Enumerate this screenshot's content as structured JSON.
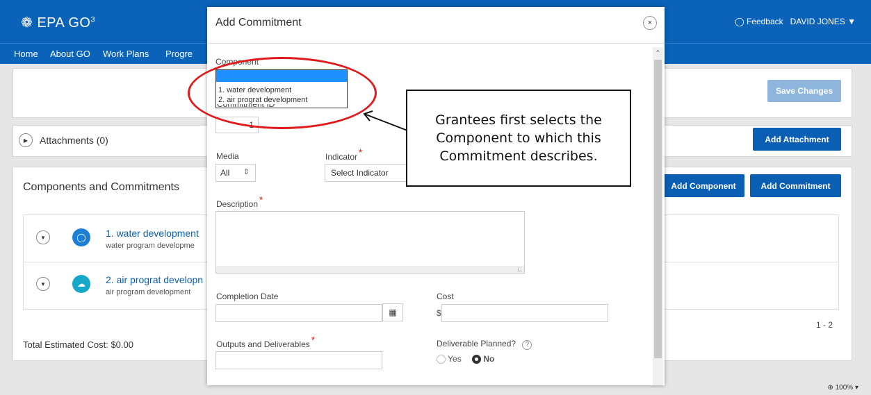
{
  "header": {
    "logo": "EPA GO",
    "logo_sup": "3",
    "feedback": "Feedback",
    "user": "DAVID JONES"
  },
  "nav": {
    "items": [
      "Home",
      "About GO",
      "Work Plans",
      "Progre"
    ]
  },
  "background": {
    "save_changes": "Save Changes",
    "attachments_label": "Attachments (0)",
    "add_attachment": "Add Attachment",
    "components_heading": "Components and Commitments",
    "add_component": "Add Component",
    "add_commitment": "Add Commitment",
    "components": [
      {
        "title": "1. water development",
        "subtitle": "water program developme",
        "icon": "water-drop-icon",
        "color": "#1b7fd6"
      },
      {
        "title": "2. air prograt developn",
        "subtitle": "air program development",
        "icon": "cloud-icon",
        "color": "#17a8c9"
      }
    ],
    "pagination": "1 - 2",
    "total_cost": "Total Estimated Cost:  $0.00"
  },
  "modal": {
    "title": "Add Commitment",
    "close": "×",
    "component_label": "Component",
    "component_options": [
      "",
      "1. water development",
      "2. air prograt development"
    ],
    "commitment_id_partial": "Commitment ID",
    "commitment_id_value": "1",
    "media_label": "Media",
    "media_value": "All",
    "indicator_label": "Indicator",
    "indicator_placeholder": "Select Indicator",
    "required_mark": "*",
    "description_label": "Description",
    "completion_date_label": "Completion Date",
    "cost_label": "Cost",
    "cost_prefix": "$",
    "outputs_label": "Outputs and Deliverables",
    "deliverable_label": "Deliverable Planned?",
    "help": "?",
    "yes": "Yes",
    "no": "No"
  },
  "annotation": {
    "callout": "Grantees first selects the Component to which this Commitment describes."
  },
  "status": {
    "zoom": "100%"
  },
  "colors": {
    "brand": "#0a63b8",
    "annotation_red": "#e01b1b"
  }
}
